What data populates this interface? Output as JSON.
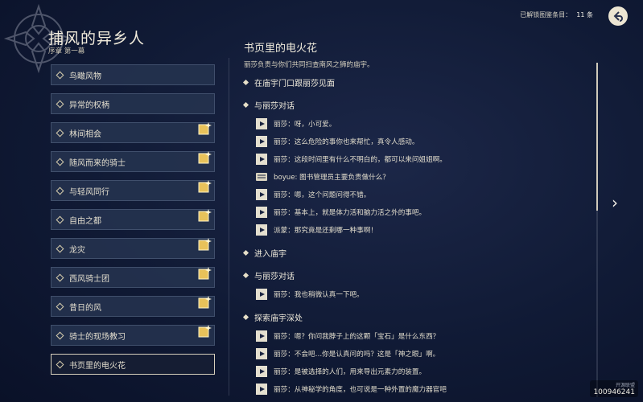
{
  "header": {
    "unlocked_label": "已解锁图鉴条目：",
    "unlocked_count": "11 条"
  },
  "quest": {
    "title": "捕风的异乡人",
    "subtitle": "序章 第一幕"
  },
  "chapters": [
    {
      "label": "鸟瞰风物",
      "badge": false
    },
    {
      "label": "异常的权柄",
      "badge": false
    },
    {
      "label": "林间相会",
      "badge": true
    },
    {
      "label": "随风而来的骑士",
      "badge": true
    },
    {
      "label": "与轻风同行",
      "badge": true
    },
    {
      "label": "自由之都",
      "badge": true
    },
    {
      "label": "龙灾",
      "badge": true
    },
    {
      "label": "西风骑士团",
      "badge": true
    },
    {
      "label": "昔日的风",
      "badge": true
    },
    {
      "label": "骑士的现场教习",
      "badge": true
    },
    {
      "label": "书页里的电火花",
      "badge": false,
      "selected": true
    }
  ],
  "detail": {
    "title": "书页里的电火花",
    "description": "丽莎负责与你们共同扫查南风之狮的庙宇。",
    "sections": [
      {
        "heading": "在庙宇门口跟丽莎见面",
        "lines": []
      },
      {
        "heading": "与丽莎对话",
        "lines": [
          {
            "type": "dialogue",
            "text": "丽莎：呀，小可爱。"
          },
          {
            "type": "dialogue",
            "text": "丽莎：这么危险的事你也来帮忙，真令人感动。"
          },
          {
            "type": "dialogue",
            "text": "丽莎：这段时间里有什么不明白的，都可以来问姐姐啊。"
          },
          {
            "type": "option",
            "text": "boyue: 图书管理员主要负责做什么？"
          },
          {
            "type": "dialogue",
            "text": "丽莎：嗯，这个问题问得不错。"
          },
          {
            "type": "dialogue",
            "text": "丽莎：基本上，就是体力活和脑力活之外的事吧。"
          },
          {
            "type": "dialogue",
            "text": "派蒙：那究竟是还剩哪一种事啊！"
          }
        ]
      },
      {
        "heading": "进入庙宇",
        "lines": []
      },
      {
        "heading": "与丽莎对话",
        "lines": [
          {
            "type": "dialogue",
            "text": "丽莎：我也稍微认真一下吧。"
          }
        ]
      },
      {
        "heading": "探索庙宇深处",
        "lines": [
          {
            "type": "dialogue",
            "text": "丽莎：嗯？你问我脖子上的这颗「宝石」是什么东西？"
          },
          {
            "type": "dialogue",
            "text": "丽莎：不会吧…你是认真问的吗？这是「神之眼」啊。"
          },
          {
            "type": "dialogue",
            "text": "丽莎：是被选择的人们，用来导出元素力的装置。"
          },
          {
            "type": "dialogue",
            "text": "丽莎：从神秘学的角度，也可说是一种外置的魔力器官吧"
          }
        ]
      }
    ]
  },
  "watermark": {
    "id": "100946241",
    "top": "开源联盟"
  },
  "colors": {
    "accent": "#ece5d2",
    "background": "#101a35",
    "badge": "#e8c25a"
  }
}
